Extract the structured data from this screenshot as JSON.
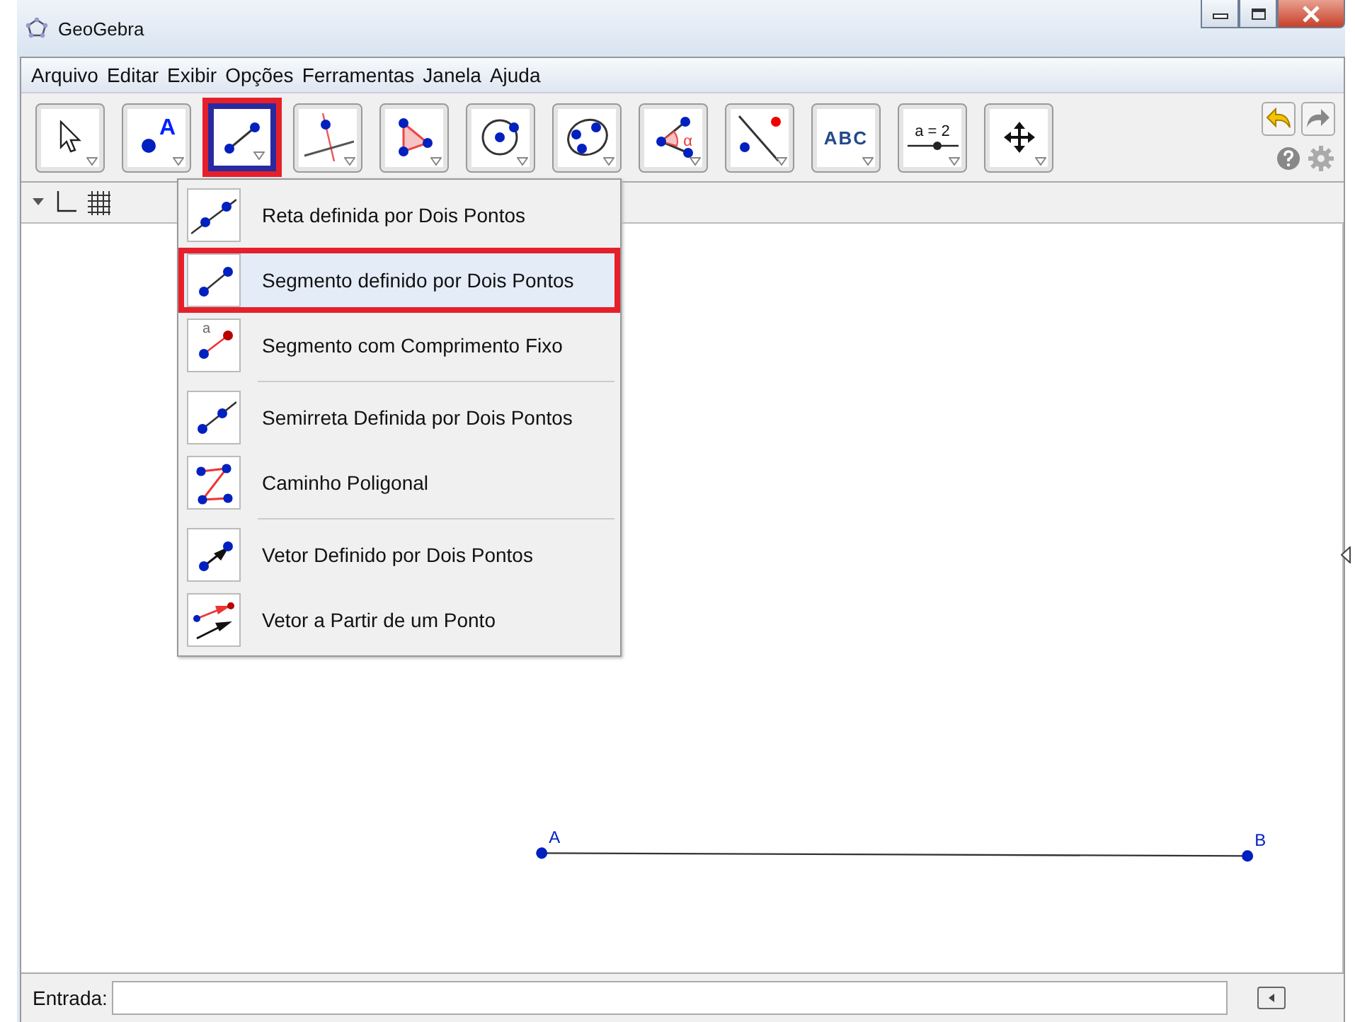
{
  "window": {
    "title": "GeoGebra"
  },
  "menu": [
    "Arquivo",
    "Editar",
    "Exibir",
    "Opções",
    "Ferramentas",
    "Janela",
    "Ajuda"
  ],
  "tools": [
    {
      "kind": "move",
      "selected": false
    },
    {
      "kind": "point",
      "label": "A",
      "selected": false
    },
    {
      "kind": "segment",
      "selected": true
    },
    {
      "kind": "perpendicular",
      "selected": false
    },
    {
      "kind": "polygon",
      "selected": false
    },
    {
      "kind": "circle",
      "selected": false
    },
    {
      "kind": "conic",
      "selected": false
    },
    {
      "kind": "angle",
      "label": "α",
      "selected": false
    },
    {
      "kind": "reflect",
      "selected": false
    },
    {
      "kind": "text",
      "label": "ABC",
      "selected": false
    },
    {
      "kind": "slider",
      "label": "a = 2",
      "selected": false
    },
    {
      "kind": "pan",
      "selected": false
    }
  ],
  "tool_menu": {
    "groups": [
      [
        {
          "kind": "line",
          "label": "Reta definida por Dois Pontos",
          "selected": false
        },
        {
          "kind": "segment",
          "label": "Segmento definido por Dois Pontos",
          "selected": true
        },
        {
          "kind": "fixed-segment",
          "icon_label": "a",
          "label": "Segmento com Comprimento Fixo",
          "selected": false
        }
      ],
      [
        {
          "kind": "ray",
          "label": "Semirreta Definida por Dois Pontos",
          "selected": false
        },
        {
          "kind": "polyline",
          "label": "Caminho Poligonal",
          "selected": false
        }
      ],
      [
        {
          "kind": "vector",
          "label": "Vetor Definido por Dois Pontos",
          "selected": false
        },
        {
          "kind": "vector-from-point",
          "label": "Vetor a Partir de um Ponto",
          "selected": false
        }
      ]
    ]
  },
  "canvas": {
    "points": [
      {
        "label": "A"
      },
      {
        "label": "B"
      }
    ]
  },
  "input_bar": {
    "label": "Entrada:"
  }
}
